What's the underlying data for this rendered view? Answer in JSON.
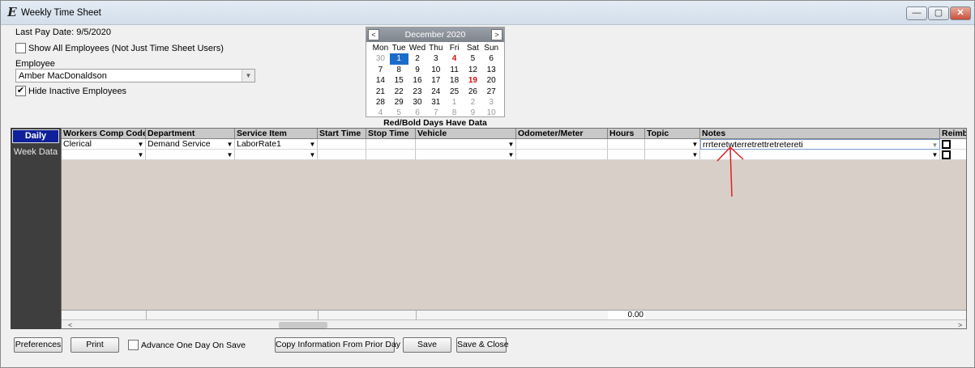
{
  "window": {
    "title": "Weekly Time Sheet",
    "min_glyph": "—",
    "max_glyph": "▢",
    "close_glyph": "✕"
  },
  "header": {
    "last_pay_date": "Last Pay Date: 9/5/2020",
    "show_all_label": "Show All Employees (Not Just Time Sheet Users)",
    "show_all_checked": false,
    "employee_label": "Employee",
    "employee_value": "Amber MacDonaldson",
    "hide_inactive_label": "Hide Inactive Employees",
    "hide_inactive_checked": true,
    "check_mark": "✔"
  },
  "calendar": {
    "month_title": "December 2020",
    "prev": "<",
    "next": ">",
    "weekdays": [
      "Mon",
      "Tue",
      "Wed",
      "Thu",
      "Fri",
      "Sat",
      "Sun"
    ],
    "days": [
      {
        "d": "30",
        "s": "muted"
      },
      {
        "d": "1",
        "s": "sel"
      },
      {
        "d": "2",
        "s": ""
      },
      {
        "d": "3",
        "s": ""
      },
      {
        "d": "4",
        "s": "red"
      },
      {
        "d": "5",
        "s": ""
      },
      {
        "d": "6",
        "s": ""
      },
      {
        "d": "7",
        "s": ""
      },
      {
        "d": "8",
        "s": ""
      },
      {
        "d": "9",
        "s": ""
      },
      {
        "d": "10",
        "s": ""
      },
      {
        "d": "11",
        "s": ""
      },
      {
        "d": "12",
        "s": ""
      },
      {
        "d": "13",
        "s": ""
      },
      {
        "d": "14",
        "s": ""
      },
      {
        "d": "15",
        "s": ""
      },
      {
        "d": "16",
        "s": ""
      },
      {
        "d": "17",
        "s": ""
      },
      {
        "d": "18",
        "s": ""
      },
      {
        "d": "19",
        "s": "red"
      },
      {
        "d": "20",
        "s": ""
      },
      {
        "d": "21",
        "s": ""
      },
      {
        "d": "22",
        "s": ""
      },
      {
        "d": "23",
        "s": ""
      },
      {
        "d": "24",
        "s": ""
      },
      {
        "d": "25",
        "s": ""
      },
      {
        "d": "26",
        "s": ""
      },
      {
        "d": "27",
        "s": ""
      },
      {
        "d": "28",
        "s": ""
      },
      {
        "d": "29",
        "s": ""
      },
      {
        "d": "30",
        "s": ""
      },
      {
        "d": "31",
        "s": ""
      },
      {
        "d": "1",
        "s": "muted"
      },
      {
        "d": "2",
        "s": "muted"
      },
      {
        "d": "3",
        "s": "muted"
      },
      {
        "d": "4",
        "s": "muted"
      },
      {
        "d": "5",
        "s": "muted"
      },
      {
        "d": "6",
        "s": "muted"
      },
      {
        "d": "7",
        "s": "muted"
      },
      {
        "d": "8",
        "s": "muted"
      },
      {
        "d": "9",
        "s": "muted"
      },
      {
        "d": "10",
        "s": "muted"
      }
    ],
    "note": "Red/Bold Days Have Data"
  },
  "tabs": {
    "daily": "Daily",
    "week_data": "Week Data"
  },
  "grid": {
    "columns": [
      "Workers Comp Code",
      "Department",
      "Service Item",
      "Start Time",
      "Stop Time",
      "Vehicle",
      "Odometer/Meter",
      "Hours",
      "Topic",
      "Notes",
      "Reimb"
    ],
    "row1": {
      "workers_comp": "Clerical",
      "department": "Demand Service",
      "service_item": "LaborRate1",
      "notes": "rrrteretwterretrettretretereti"
    },
    "hours_total": "0.00",
    "scroll_left": "<",
    "scroll_right": ">"
  },
  "buttons": {
    "preferences": "Preferences",
    "print": "Print",
    "advance_label": "Advance One Day On Save",
    "advance_checked": false,
    "copy": "Copy Information From Prior Day",
    "save": "Save",
    "save_close": "Save & Close"
  },
  "colors": {
    "accent_tab": "#10209a",
    "calendar_selected": "#1a6cc8",
    "calendar_has_data": "#d01010",
    "annotation": "#e02020"
  }
}
